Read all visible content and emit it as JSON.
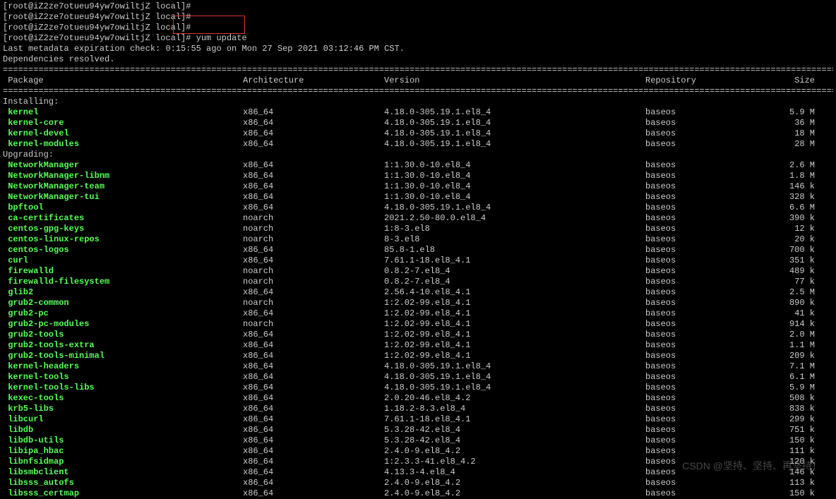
{
  "prompts": [
    "[root@iZ2ze7otueu94yw7owiltjZ local]#",
    "[root@iZ2ze7otueu94yw7owiltjZ local]#",
    "[root@iZ2ze7otueu94yw7owiltjZ local]#",
    "[root@iZ2ze7otueu94yw7owiltjZ local]# yum update"
  ],
  "meta_line": "Last metadata expiration check: 0:15:55 ago on Mon 27 Sep 2021 03:12:46 PM CST.",
  "deps_line": "Dependencies resolved.",
  "divider": "================================================================================================================================================================================================",
  "headers": {
    "pkg": " Package",
    "arch": "Architecture",
    "ver": "Version",
    "repo": "Repository",
    "size": "Size"
  },
  "sections": [
    {
      "label": "Installing:",
      "rows": [
        {
          "pkg": "kernel",
          "arch": "x86_64",
          "ver": "4.18.0-305.19.1.el8_4",
          "repo": "baseos",
          "size": "5.9 M"
        },
        {
          "pkg": "kernel-core",
          "arch": "x86_64",
          "ver": "4.18.0-305.19.1.el8_4",
          "repo": "baseos",
          "size": "36 M"
        },
        {
          "pkg": "kernel-devel",
          "arch": "x86_64",
          "ver": "4.18.0-305.19.1.el8_4",
          "repo": "baseos",
          "size": "18 M"
        },
        {
          "pkg": "kernel-modules",
          "arch": "x86_64",
          "ver": "4.18.0-305.19.1.el8_4",
          "repo": "baseos",
          "size": "28 M"
        }
      ]
    },
    {
      "label": "Upgrading:",
      "rows": [
        {
          "pkg": "NetworkManager",
          "arch": "x86_64",
          "ver": "1:1.30.0-10.el8_4",
          "repo": "baseos",
          "size": "2.6 M"
        },
        {
          "pkg": "NetworkManager-libnm",
          "arch": "x86_64",
          "ver": "1:1.30.0-10.el8_4",
          "repo": "baseos",
          "size": "1.8 M"
        },
        {
          "pkg": "NetworkManager-team",
          "arch": "x86_64",
          "ver": "1:1.30.0-10.el8_4",
          "repo": "baseos",
          "size": "146 k"
        },
        {
          "pkg": "NetworkManager-tui",
          "arch": "x86_64",
          "ver": "1:1.30.0-10.el8_4",
          "repo": "baseos",
          "size": "328 k"
        },
        {
          "pkg": "bpftool",
          "arch": "x86_64",
          "ver": "4.18.0-305.19.1.el8_4",
          "repo": "baseos",
          "size": "6.6 M"
        },
        {
          "pkg": "ca-certificates",
          "arch": "noarch",
          "ver": "2021.2.50-80.0.el8_4",
          "repo": "baseos",
          "size": "390 k"
        },
        {
          "pkg": "centos-gpg-keys",
          "arch": "noarch",
          "ver": "1:8-3.el8",
          "repo": "baseos",
          "size": "12 k"
        },
        {
          "pkg": "centos-linux-repos",
          "arch": "noarch",
          "ver": "8-3.el8",
          "repo": "baseos",
          "size": "20 k"
        },
        {
          "pkg": "centos-logos",
          "arch": "x86_64",
          "ver": "85.8-1.el8",
          "repo": "baseos",
          "size": "700 k"
        },
        {
          "pkg": "curl",
          "arch": "x86_64",
          "ver": "7.61.1-18.el8_4.1",
          "repo": "baseos",
          "size": "351 k"
        },
        {
          "pkg": "firewalld",
          "arch": "noarch",
          "ver": "0.8.2-7.el8_4",
          "repo": "baseos",
          "size": "489 k"
        },
        {
          "pkg": "firewalld-filesystem",
          "arch": "noarch",
          "ver": "0.8.2-7.el8_4",
          "repo": "baseos",
          "size": "77 k"
        },
        {
          "pkg": "glib2",
          "arch": "x86_64",
          "ver": "2.56.4-10.el8_4.1",
          "repo": "baseos",
          "size": "2.5 M"
        },
        {
          "pkg": "grub2-common",
          "arch": "noarch",
          "ver": "1:2.02-99.el8_4.1",
          "repo": "baseos",
          "size": "890 k"
        },
        {
          "pkg": "grub2-pc",
          "arch": "x86_64",
          "ver": "1:2.02-99.el8_4.1",
          "repo": "baseos",
          "size": "41 k"
        },
        {
          "pkg": "grub2-pc-modules",
          "arch": "noarch",
          "ver": "1:2.02-99.el8_4.1",
          "repo": "baseos",
          "size": "914 k"
        },
        {
          "pkg": "grub2-tools",
          "arch": "x86_64",
          "ver": "1:2.02-99.el8_4.1",
          "repo": "baseos",
          "size": "2.0 M"
        },
        {
          "pkg": "grub2-tools-extra",
          "arch": "x86_64",
          "ver": "1:2.02-99.el8_4.1",
          "repo": "baseos",
          "size": "1.1 M"
        },
        {
          "pkg": "grub2-tools-minimal",
          "arch": "x86_64",
          "ver": "1:2.02-99.el8_4.1",
          "repo": "baseos",
          "size": "209 k"
        },
        {
          "pkg": "kernel-headers",
          "arch": "x86_64",
          "ver": "4.18.0-305.19.1.el8_4",
          "repo": "baseos",
          "size": "7.1 M"
        },
        {
          "pkg": "kernel-tools",
          "arch": "x86_64",
          "ver": "4.18.0-305.19.1.el8_4",
          "repo": "baseos",
          "size": "6.1 M"
        },
        {
          "pkg": "kernel-tools-libs",
          "arch": "x86_64",
          "ver": "4.18.0-305.19.1.el8_4",
          "repo": "baseos",
          "size": "5.9 M"
        },
        {
          "pkg": "kexec-tools",
          "arch": "x86_64",
          "ver": "2.0.20-46.el8_4.2",
          "repo": "baseos",
          "size": "508 k"
        },
        {
          "pkg": "krb5-libs",
          "arch": "x86_64",
          "ver": "1.18.2-8.3.el8_4",
          "repo": "baseos",
          "size": "838 k"
        },
        {
          "pkg": "libcurl",
          "arch": "x86_64",
          "ver": "7.61.1-18.el8_4.1",
          "repo": "baseos",
          "size": "299 k"
        },
        {
          "pkg": "libdb",
          "arch": "x86_64",
          "ver": "5.3.28-42.el8_4",
          "repo": "baseos",
          "size": "751 k"
        },
        {
          "pkg": "libdb-utils",
          "arch": "x86_64",
          "ver": "5.3.28-42.el8_4",
          "repo": "baseos",
          "size": "150 k"
        },
        {
          "pkg": "libipa_hbac",
          "arch": "x86_64",
          "ver": "2.4.0-9.el8_4.2",
          "repo": "baseos",
          "size": "111 k"
        },
        {
          "pkg": "libnfsidmap",
          "arch": "x86_64",
          "ver": "1:2.3.3-41.el8_4.2",
          "repo": "baseos",
          "size": "120 k"
        },
        {
          "pkg": "libsmbclient",
          "arch": "x86_64",
          "ver": "4.13.3-4.el8_4",
          "repo": "baseos",
          "size": "146 k"
        },
        {
          "pkg": "libsss_autofs",
          "arch": "x86_64",
          "ver": "2.4.0-9.el8_4.2",
          "repo": "baseos",
          "size": "113 k"
        },
        {
          "pkg": "libsss_certmap",
          "arch": "x86_64",
          "ver": "2.4.0-9.el8_4.2",
          "repo": "baseos",
          "size": "150 k"
        }
      ]
    }
  ],
  "watermark": "CSDN @坚持、坚持、再坚持！"
}
